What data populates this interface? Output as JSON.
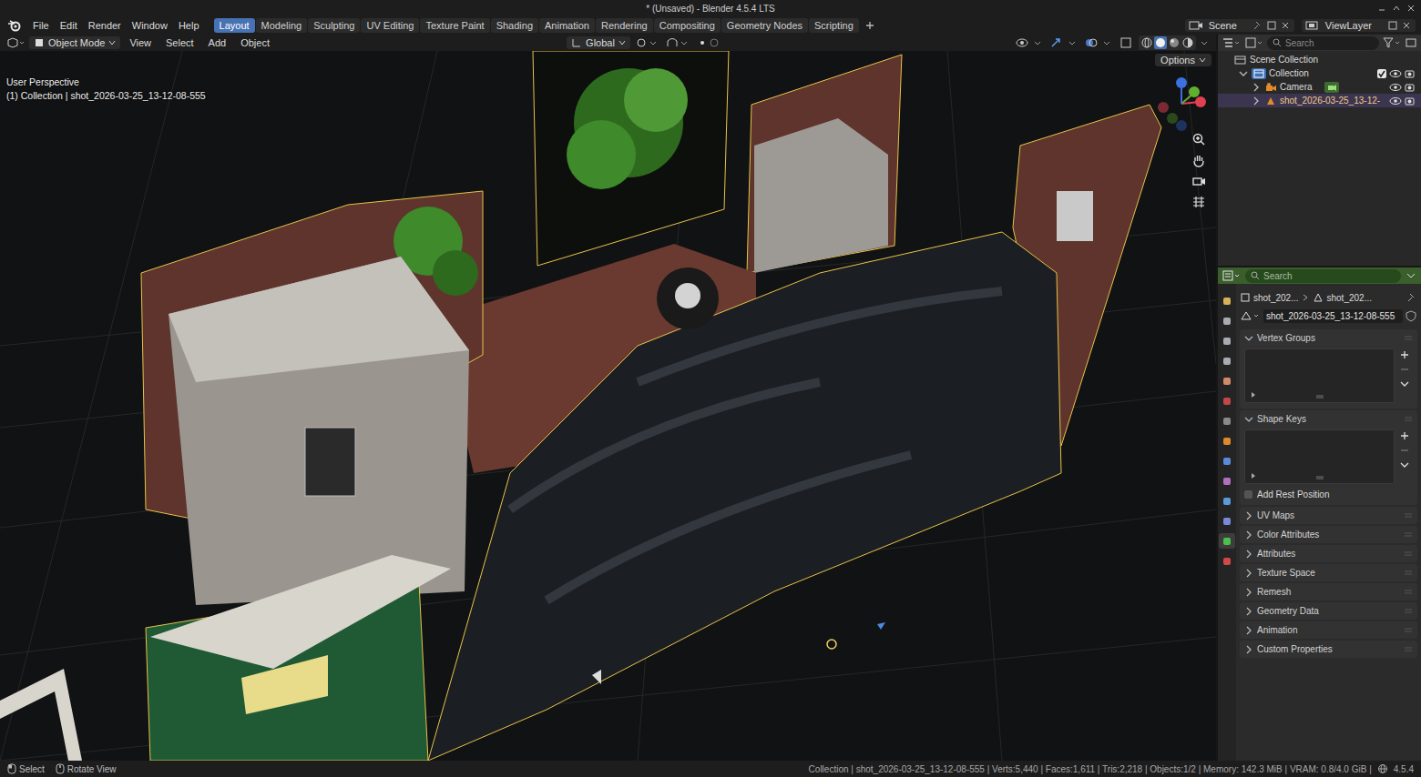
{
  "window": {
    "title": "* (Unsaved) - Blender 4.5.4 LTS"
  },
  "menus": [
    "File",
    "Edit",
    "Render",
    "Window",
    "Help"
  ],
  "workspaces": [
    {
      "label": "Layout",
      "selected": true
    },
    {
      "label": "Modeling",
      "selected": false
    },
    {
      "label": "Sculpting",
      "selected": false
    },
    {
      "label": "UV Editing",
      "selected": false
    },
    {
      "label": "Texture Paint",
      "selected": false
    },
    {
      "label": "Shading",
      "selected": false
    },
    {
      "label": "Animation",
      "selected": false
    },
    {
      "label": "Rendering",
      "selected": false
    },
    {
      "label": "Compositing",
      "selected": false
    },
    {
      "label": "Geometry Nodes",
      "selected": false
    },
    {
      "label": "Scripting",
      "selected": false
    }
  ],
  "scene": {
    "scene": "Scene",
    "view_layer": "ViewLayer"
  },
  "viewport": {
    "mode": "Object Mode",
    "menus": [
      "View",
      "Select",
      "Add",
      "Object"
    ],
    "orientation": "Global",
    "options": "Options",
    "perspective": "User Perspective",
    "context": "(1) Collection | shot_2026-03-25_13-12-08-555"
  },
  "outliner": {
    "search": "Search",
    "root": "Scene Collection",
    "collection": {
      "label": "Collection",
      "expanded": true,
      "checked": true
    },
    "objects": [
      {
        "label": "Camera",
        "kind": "camera",
        "selected": false,
        "expanded": false
      },
      {
        "label": "shot_2026-03-25_13-12-",
        "kind": "mesh",
        "selected": true,
        "expanded": false
      }
    ]
  },
  "properties": {
    "search": "Search",
    "tabs": [
      {
        "selected": false,
        "color": "#d8b25a"
      },
      {
        "selected": false,
        "color": "#a8acb2"
      },
      {
        "selected": false,
        "color": "#a8acb2"
      },
      {
        "selected": false,
        "color": "#a8acb2"
      },
      {
        "selected": false,
        "color": "#d08a6a"
      },
      {
        "selected": false,
        "color": "#c04848"
      },
      {
        "selected": false,
        "color": "#8a8a8a"
      },
      {
        "selected": false,
        "color": "#e08a2a"
      },
      {
        "selected": false,
        "color": "#5a8ad8"
      },
      {
        "selected": false,
        "color": "#b070c0"
      },
      {
        "selected": false,
        "color": "#5a9ad8"
      },
      {
        "selected": false,
        "color": "#7a8ad8"
      },
      {
        "selected": true,
        "color": "#4bc04b"
      },
      {
        "selected": false,
        "color": "#d04848"
      }
    ],
    "breadcrumb": [
      "shot_202...",
      "shot_202..."
    ],
    "mesh_name": "shot_2026-03-25_13-12-08-555",
    "panels": [
      {
        "label": "Vertex Groups",
        "expanded": true
      },
      {
        "label": "Shape Keys",
        "expanded": true,
        "option": {
          "label": "Add Rest Position",
          "checked": false
        }
      },
      {
        "label": "UV Maps",
        "expanded": false
      },
      {
        "label": "Color Attributes",
        "expanded": false
      },
      {
        "label": "Attributes",
        "expanded": false
      },
      {
        "label": "Texture Space",
        "expanded": false
      },
      {
        "label": "Remesh",
        "expanded": false
      },
      {
        "label": "Geometry Data",
        "expanded": false
      },
      {
        "label": "Animation",
        "expanded": false
      },
      {
        "label": "Custom Properties",
        "expanded": false
      }
    ]
  },
  "status_bar": {
    "hints": [
      "Select",
      "Rotate View"
    ],
    "info": "Collection | shot_2026-03-25_13-12-08-555 | Verts:5,440 | Faces:1,611 | Tris:2,218 | Objects:1/2 | Memory: 142.3 MiB | VRAM: 0.8/4.0 GiB |",
    "version": "4.5.4"
  }
}
